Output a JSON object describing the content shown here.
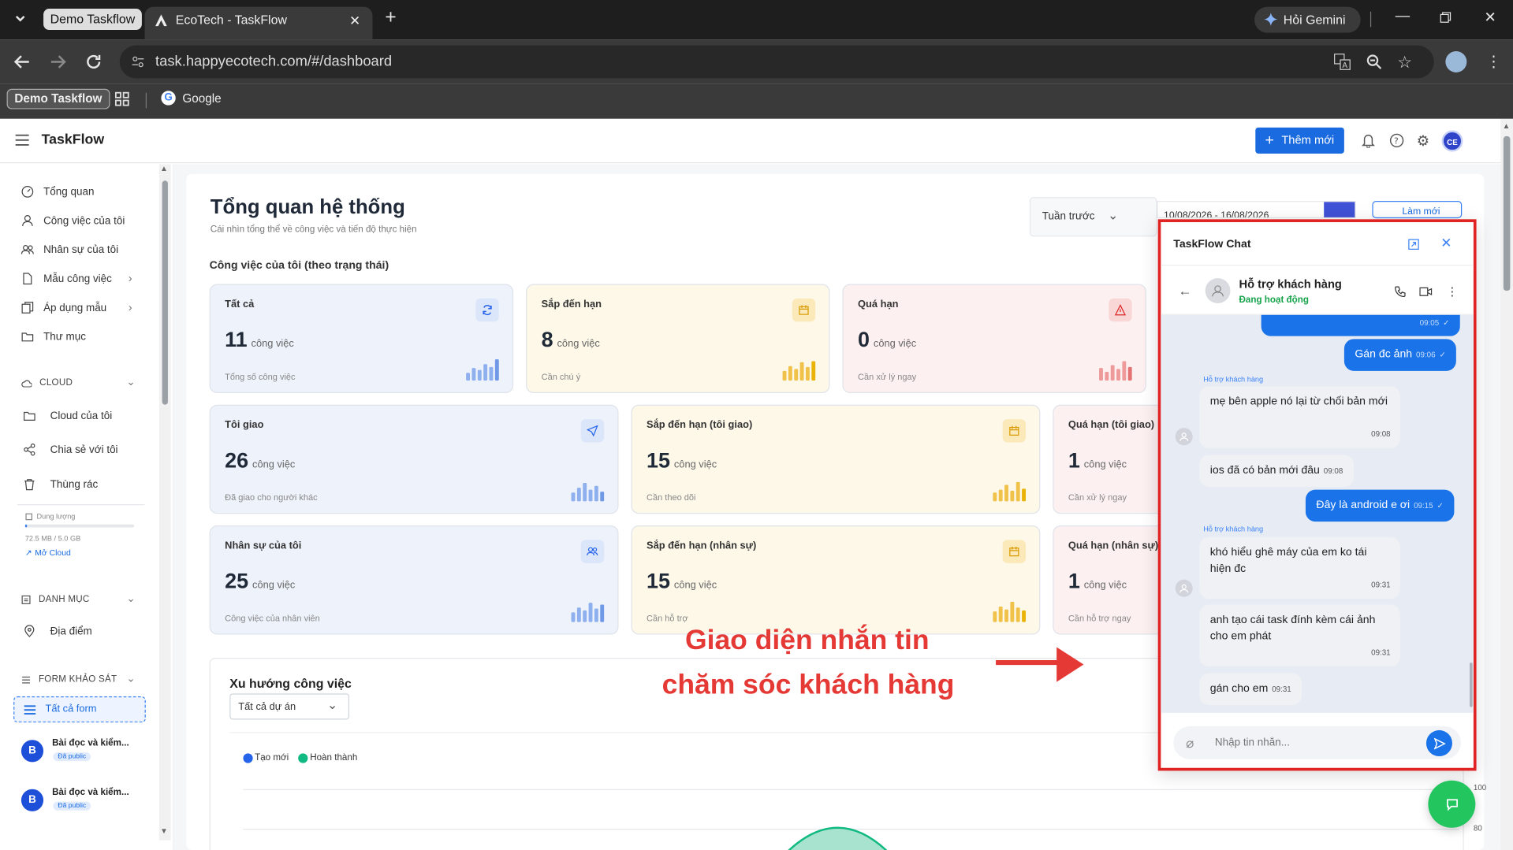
{
  "browser": {
    "tab_group_label": "Demo Taskflow",
    "active_tab_title": "EcoTech - TaskFlow",
    "gemini_label": "Hỏi Gemini",
    "url": "task.happyecotech.com/#/dashboard",
    "bookmarks": {
      "group": "Demo Taskflow",
      "google": "Google"
    }
  },
  "app": {
    "name": "TaskFlow",
    "add_button": "Thêm mới",
    "user_initials": "CE"
  },
  "sidebar": {
    "items": [
      {
        "label": "Tổng quan",
        "icon": "dashboard-icon"
      },
      {
        "label": "Công việc của tôi",
        "icon": "user-icon"
      },
      {
        "label": "Nhân sự của tôi",
        "icon": "users-icon"
      },
      {
        "label": "Mẫu công việc",
        "icon": "file-icon"
      },
      {
        "label": "Áp dụng mẫu",
        "icon": "copy-icon"
      },
      {
        "label": "Thư mục",
        "icon": "folder-icon"
      }
    ],
    "cloud": {
      "section": "CLOUD",
      "items": [
        "Cloud của tôi",
        "Chia sẻ với tôi",
        "Thùng rác"
      ],
      "storage_label": "Dung lượng",
      "storage_value": "72.5 MB / 5.0 GB",
      "storage_fraction": 0.014,
      "open_cloud": "Mở Cloud"
    },
    "category": {
      "section": "DANH MỤC",
      "items": [
        "Địa điểm"
      ]
    },
    "forms": {
      "section": "FORM KHẢO SÁT",
      "all_forms": "Tất cả form",
      "entries": [
        {
          "avatar": "B",
          "title": "Bài đọc và kiểm...",
          "badge": "Đã public"
        },
        {
          "avatar": "B",
          "title": "Bài đọc và kiểm...",
          "badge": "Đã public"
        }
      ]
    }
  },
  "dashboard": {
    "title": "Tổng quan hệ thống",
    "subtitle": "Cái nhìn tổng thể về công việc và tiến độ thực hiện",
    "period_select": "Tuần trước",
    "date_range": "10/08/2026 - 16/08/2026",
    "refresh_label": "Làm mới",
    "status_section": "Công việc của tôi (theo trạng thái)",
    "unit": "công việc",
    "cards_row1": [
      {
        "title": "Tất cả",
        "value": "11",
        "sub": "Tổng số công việc",
        "icon": "refresh-icon"
      },
      {
        "title": "Sắp đến hạn",
        "value": "8",
        "sub": "Cần chú ý",
        "icon": "calendar-icon"
      },
      {
        "title": "Quá hạn",
        "value": "0",
        "sub": "Cần xử lý ngay",
        "icon": "warning-icon"
      }
    ],
    "cards_row2": [
      {
        "title": "Tôi giao",
        "value": "26",
        "sub": "Đã giao cho người khác",
        "icon": "send-icon"
      },
      {
        "title": "Sắp đến hạn (tôi giao)",
        "value": "15",
        "sub": "Cần theo dõi",
        "icon": "calendar-icon"
      },
      {
        "title": "Quá hạn (tôi giao)",
        "value": "1",
        "sub": "Cần xử lý ngay"
      }
    ],
    "cards_row3": [
      {
        "title": "Nhân sự của tôi",
        "value": "25",
        "sub": "Công việc của nhân viên",
        "icon": "users-icon"
      },
      {
        "title": "Sắp đến hạn (nhân sự)",
        "value": "15",
        "sub": "Cần hỗ trợ",
        "icon": "calendar-icon"
      },
      {
        "title": "Quá hạn (nhân sự)",
        "value": "1",
        "sub": "Cần hỗ trợ ngay"
      }
    ],
    "trend": {
      "title": "Xu hướng công việc",
      "project_select": "Tất cả dự án",
      "legend": [
        {
          "name": "Tạo mới",
          "color": "#2563eb"
        },
        {
          "name": "Hoàn thành",
          "color": "#10b981"
        }
      ],
      "y_ticks": [
        "100",
        "80"
      ]
    }
  },
  "chat": {
    "window_title": "TaskFlow Chat",
    "contact_name": "Hỗ trợ khách hàng",
    "contact_status": "Đang hoạt động",
    "messages": [
      {
        "from": "me",
        "text": "",
        "time": "09:05"
      },
      {
        "from": "me",
        "text": "Gán đc ảnh",
        "time": "09:06"
      },
      {
        "from": "them",
        "sender": "Hỗ trợ khách hàng",
        "text": "mẹ bên apple nó lại từ chối bản mới",
        "time": "09:08"
      },
      {
        "from": "them",
        "text": "ios đã có bản mới đâu",
        "time": "09:08"
      },
      {
        "from": "me",
        "text": "Đây là android e ơi",
        "time": "09:15"
      },
      {
        "from": "them",
        "sender": "Hỗ trợ khách hàng",
        "text": "khó hiểu ghê máy của em ko tái hiện đc",
        "time": "09:31"
      },
      {
        "from": "them",
        "text": "anh tạo cái task đính kèm cái ảnh cho em phát",
        "time": "09:31"
      },
      {
        "from": "them",
        "text": "gán cho em",
        "time": "09:31"
      }
    ],
    "input_placeholder": "Nhập tin nhắn..."
  },
  "annotation": {
    "line1": "Giao diện nhắn tin",
    "line2": "chăm sóc khách hàng",
    "color": "#e53935"
  }
}
